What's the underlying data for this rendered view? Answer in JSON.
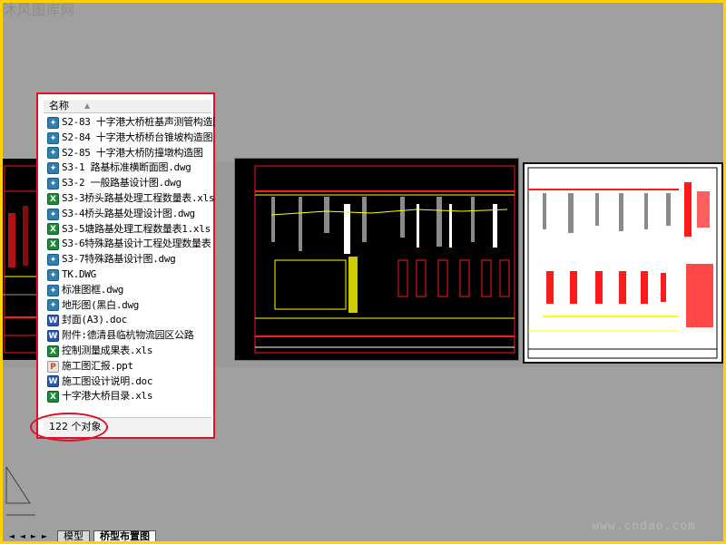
{
  "watermark": {
    "top_left": "沐风图库网",
    "bottom_right": "www.cndao.com"
  },
  "panel": {
    "column_header": "名称",
    "status": "122 个对象",
    "files": [
      {
        "name": "S2-83 十字港大桥桩基声测管构造图",
        "type": "dwg"
      },
      {
        "name": "S2-84 十字港大桥桥台锥坡构造图",
        "type": "dwg"
      },
      {
        "name": "S2-85 十字港大桥防撞墩构造图",
        "type": "dwg"
      },
      {
        "name": "S3-1 路基标准横断面图.dwg",
        "type": "dwg"
      },
      {
        "name": "S3-2 一般路基设计图.dwg",
        "type": "dwg"
      },
      {
        "name": "S3-3桥头路基处理工程数量表.xls",
        "type": "xls"
      },
      {
        "name": "S3-4桥头路基处理设计图.dwg",
        "type": "dwg"
      },
      {
        "name": "S3-5塘路基处理工程数量表1.xls",
        "type": "xls"
      },
      {
        "name": "S3-6特殊路基设计工程处理数量表",
        "type": "xls"
      },
      {
        "name": "S3-7特殊路基设计图.dwg",
        "type": "dwg"
      },
      {
        "name": "TK.DWG",
        "type": "dwg"
      },
      {
        "name": "标准图框.dwg",
        "type": "dwg"
      },
      {
        "name": "地形图(黑白.dwg",
        "type": "dwg"
      },
      {
        "name": "封面(A3).doc",
        "type": "doc"
      },
      {
        "name": "附件:德清县临杭物流园区公路",
        "type": "doc"
      },
      {
        "name": "控制测量成果表.xls",
        "type": "xls"
      },
      {
        "name": "施工图汇报.ppt",
        "type": "ppt"
      },
      {
        "name": "施工图设计说明.doc",
        "type": "doc"
      },
      {
        "name": "十字港大桥目录.xls",
        "type": "xls"
      }
    ]
  },
  "tabs": {
    "model": "模型",
    "layout": "桥型布置图"
  },
  "icons": {
    "dwg": "dwg-file-icon",
    "xls": "excel-file-icon",
    "doc": "word-file-icon",
    "ppt": "powerpoint-file-icon"
  },
  "colors": {
    "cad_red": "#ff1a1a",
    "cad_yellow": "#ffff00",
    "highlight_red": "#e0102a",
    "frame_yellow": "#ffd400"
  }
}
